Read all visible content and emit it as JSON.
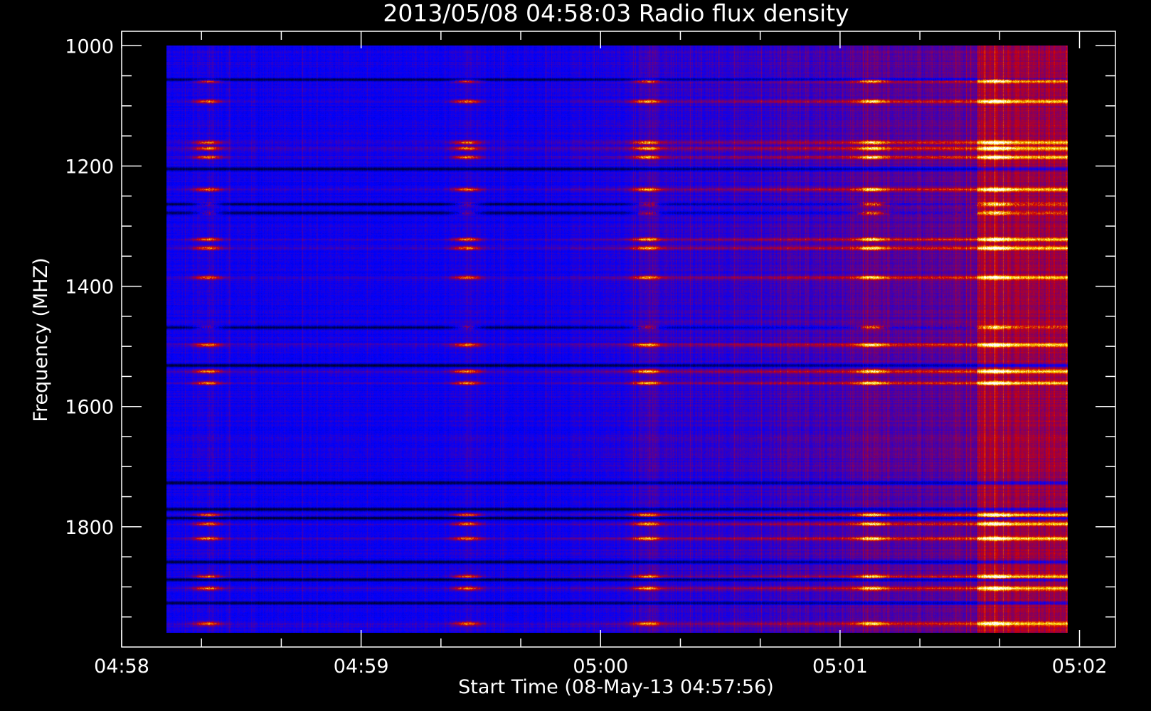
{
  "chart_data": {
    "type": "heatmap",
    "title": "2013/05/08 04:58:03 Radio flux density",
    "xlabel": "Start Time (08-May-13 04:57:56)",
    "ylabel": "Frequency (MHZ)",
    "x_ticks": [
      {
        "value": 0,
        "label": "04:58"
      },
      {
        "value": 60,
        "label": "04:59"
      },
      {
        "value": 120,
        "label": "05:00"
      },
      {
        "value": 180,
        "label": "05:01"
      },
      {
        "value": 240,
        "label": "05:02"
      }
    ],
    "x_minor_step": 20,
    "xlim": [
      0,
      249
    ],
    "data_xlim": [
      12,
      252
    ],
    "y_ticks": [
      {
        "value": 1000,
        "label": "1000"
      },
      {
        "value": 1200,
        "label": "1200"
      },
      {
        "value": 1400,
        "label": "1400"
      },
      {
        "value": 1600,
        "label": "1600"
      },
      {
        "value": 1800,
        "label": "1800"
      }
    ],
    "y_minor_step": 50,
    "ylim": [
      976,
      2000
    ],
    "data_ylim": [
      1000,
      2000
    ],
    "y_inverted": true,
    "colormap": [
      "#000000",
      "#0000ff",
      "#ff0000",
      "#ffff00",
      "#ffffff"
    ],
    "features": {
      "bright_bands_mhz": [
        1060,
        1095,
        1165,
        1175,
        1190,
        1245,
        1270,
        1285,
        1330,
        1345,
        1395,
        1480,
        1510,
        1555,
        1575,
        1800,
        1815,
        1840,
        1905,
        1925,
        1985
      ],
      "dark_bands_mhz": [
        1058,
        1210,
        1270,
        1285,
        1480,
        1545,
        1745,
        1790,
        1805,
        1880,
        1910,
        1950
      ],
      "burst_times_s": [
        23,
        92,
        140,
        200,
        233
      ]
    }
  }
}
